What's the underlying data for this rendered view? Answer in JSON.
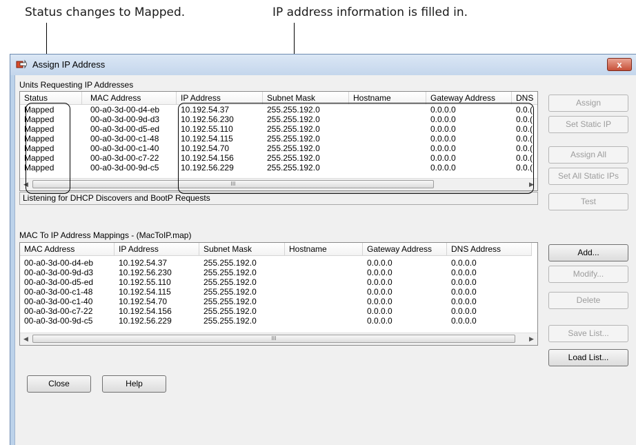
{
  "callouts": {
    "status": "Status changes to Mapped.",
    "ip": "IP address information is filled in."
  },
  "window": {
    "title": "Assign IP Address",
    "close_glyph": "x",
    "app_icon": "network-arrow-icon"
  },
  "requests": {
    "label": "Units Requesting IP Addresses",
    "columns": [
      "Status",
      "MAC Address",
      "IP Address",
      "Subnet Mask",
      "Hostname",
      "Gateway Address",
      "DNS"
    ],
    "rows": [
      [
        "Mapped",
        "00-a0-3d-00-d4-eb",
        "10.192.54.37",
        "255.255.192.0",
        "",
        "0.0.0.0",
        "0.0.("
      ],
      [
        "Mapped",
        "00-a0-3d-00-9d-d3",
        "10.192.56.230",
        "255.255.192.0",
        "",
        "0.0.0.0",
        "0.0.("
      ],
      [
        "Mapped",
        "00-a0-3d-00-d5-ed",
        "10.192.55.110",
        "255.255.192.0",
        "",
        "0.0.0.0",
        "0.0.("
      ],
      [
        "Mapped",
        "00-a0-3d-00-c1-48",
        "10.192.54.115",
        "255.255.192.0",
        "",
        "0.0.0.0",
        "0.0.("
      ],
      [
        "Mapped",
        "00-a0-3d-00-c1-40",
        "10.192.54.70",
        "255.255.192.0",
        "",
        "0.0.0.0",
        "0.0.("
      ],
      [
        "Mapped",
        "00-a0-3d-00-c7-22",
        "10.192.54.156",
        "255.255.192.0",
        "",
        "0.0.0.0",
        "0.0.("
      ],
      [
        "Mapped",
        "00-a0-3d-00-9d-c5",
        "10.192.56.229",
        "255.255.192.0",
        "",
        "0.0.0.0",
        "0.0.("
      ]
    ],
    "status_text": "Listening for DHCP Discovers and BootP Requests"
  },
  "mappings": {
    "label": "MAC To IP Address Mappings - (MacToIP.map)",
    "columns": [
      "MAC Address",
      "IP Address",
      "Subnet Mask",
      "Hostname",
      "Gateway Address",
      "DNS Address"
    ],
    "rows": [
      [
        "00-a0-3d-00-d4-eb",
        "10.192.54.37",
        "255.255.192.0",
        "",
        "0.0.0.0",
        "0.0.0.0"
      ],
      [
        "00-a0-3d-00-9d-d3",
        "10.192.56.230",
        "255.255.192.0",
        "",
        "0.0.0.0",
        "0.0.0.0"
      ],
      [
        "00-a0-3d-00-d5-ed",
        "10.192.55.110",
        "255.255.192.0",
        "",
        "0.0.0.0",
        "0.0.0.0"
      ],
      [
        "00-a0-3d-00-c1-48",
        "10.192.54.115",
        "255.255.192.0",
        "",
        "0.0.0.0",
        "0.0.0.0"
      ],
      [
        "00-a0-3d-00-c1-40",
        "10.192.54.70",
        "255.255.192.0",
        "",
        "0.0.0.0",
        "0.0.0.0"
      ],
      [
        "00-a0-3d-00-c7-22",
        "10.192.54.156",
        "255.255.192.0",
        "",
        "0.0.0.0",
        "0.0.0.0"
      ],
      [
        "00-a0-3d-00-9d-c5",
        "10.192.56.229",
        "255.255.192.0",
        "",
        "0.0.0.0",
        "0.0.0.0"
      ]
    ]
  },
  "buttons": {
    "assign": "Assign",
    "set_static_ip": "Set Static IP",
    "assign_all": "Assign All",
    "set_all_static_ips": "Set All Static IPs",
    "test": "Test",
    "add": "Add...",
    "modify": "Modify...",
    "delete": "Delete",
    "save_list": "Save List...",
    "load_list": "Load List...",
    "close": "Close",
    "help": "Help"
  },
  "scrollbar": {
    "left_glyph": "◀",
    "right_glyph": "▶",
    "thumb_glyph": "III"
  },
  "colors": {
    "title_gradient_top": "#dbe7f5",
    "close_button": "#c75038",
    "disabled_text": "#9c9c9c"
  }
}
